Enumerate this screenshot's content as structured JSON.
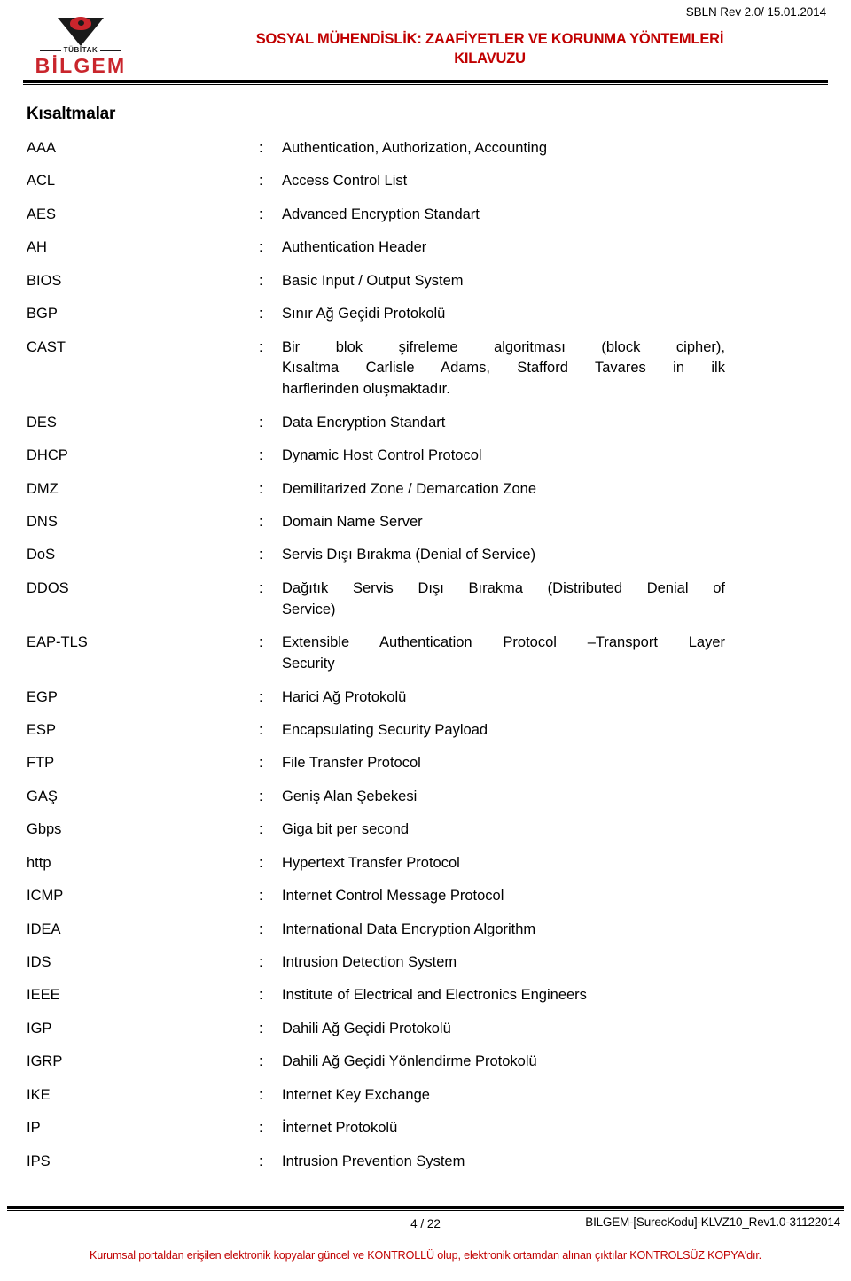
{
  "header": {
    "revision": "SBLN Rev 2.0/ 15.01.2014",
    "logo": {
      "mark_name": "tubitak-triangle-logo",
      "tubitak_text": "TÜBİTAK",
      "bilgem_text": "BİLGEM",
      "red_hex": "#c9252c"
    },
    "title_line1": "SOSYAL MÜHENDİSLİK: ZAAFİYETLER VE KORUNMA YÖNTEMLERİ",
    "title_line2": "KILAVUZU",
    "title_color_hex": "#c00000"
  },
  "main": {
    "section_title": "Kısaltmalar",
    "separator": ":",
    "abbreviations": [
      {
        "term": "AAA",
        "definition": "Authentication, Authorization, Accounting"
      },
      {
        "term": "ACL",
        "definition": "Access Control List"
      },
      {
        "term": "AES",
        "definition": "Advanced Encryption Standart"
      },
      {
        "term": "AH",
        "definition": "Authentication Header"
      },
      {
        "term": "BIOS",
        "definition": "Basic Input / Output System"
      },
      {
        "term": "BGP",
        "definition": "Sınır Ağ Geçidi Protokolü"
      },
      {
        "term": "CAST",
        "definition": "Bir blok şifreleme algoritması (block cipher), Kısaltma Carlisle Adams, Stafford Tavares in ilk harflerinden oluşmaktadır.",
        "lines": [
          "Bir blok şifreleme algoritması (block cipher),",
          "Kısaltma Carlisle Adams, Stafford Tavares in ilk",
          "harflerinden oluşmaktadır."
        ]
      },
      {
        "term": "DES",
        "definition": "Data Encryption Standart"
      },
      {
        "term": "DHCP",
        "definition": "Dynamic Host Control Protocol"
      },
      {
        "term": "DMZ",
        "definition": "Demilitarized Zone / Demarcation Zone"
      },
      {
        "term": "DNS",
        "definition": "Domain Name Server"
      },
      {
        "term": "DoS",
        "definition": "Servis Dışı Bırakma (Denial of Service)"
      },
      {
        "term": "DDOS",
        "definition": "Dağıtık Servis Dışı Bırakma (Distributed Denial of Service)",
        "lines": [
          "Dağıtık Servis Dışı Bırakma (Distributed Denial of",
          "Service)"
        ]
      },
      {
        "term": "EAP-TLS",
        "definition": "Extensible Authentication Protocol –Transport Layer Security",
        "lines": [
          "Extensible Authentication Protocol –Transport Layer",
          "Security"
        ]
      },
      {
        "term": "EGP",
        "definition": "Harici Ağ Protokolü"
      },
      {
        "term": "ESP",
        "definition": "Encapsulating Security Payload"
      },
      {
        "term": "FTP",
        "definition": "File Transfer Protocol"
      },
      {
        "term": "GAŞ",
        "definition": "Geniş Alan Şebekesi"
      },
      {
        "term": "Gbps",
        "definition": "Giga bit per second"
      },
      {
        "term": "http",
        "definition": "Hypertext Transfer Protocol"
      },
      {
        "term": "ICMP",
        "definition": "Internet Control Message Protocol"
      },
      {
        "term": "IDEA",
        "definition": "International Data Encryption Algorithm"
      },
      {
        "term": "IDS",
        "definition": "Intrusion Detection System"
      },
      {
        "term": "IEEE",
        "definition": "Institute of Electrical and Electronics Engineers"
      },
      {
        "term": "IGP",
        "definition": "Dahili Ağ Geçidi Protokolü"
      },
      {
        "term": "IGRP",
        "definition": "Dahili Ağ Geçidi Yönlendirme Protokolü"
      },
      {
        "term": "IKE",
        "definition": "Internet Key Exchange"
      },
      {
        "term": "IP",
        "definition": "İnternet Protokolü"
      },
      {
        "term": "IPS",
        "definition": "Intrusion Prevention System"
      }
    ]
  },
  "footer": {
    "page_number": "4 / 22",
    "document_code": "BILGEM-[SurecKodu]-KLVZ10_Rev1.0-31122014",
    "notice": "Kurumsal portaldan erişilen elektronik kopyalar güncel ve KONTROLLÜ olup, elektronik ortamdan alınan çıktılar KONTROLSÜZ KOPYA'dır.",
    "notice_color_hex": "#c00000"
  }
}
